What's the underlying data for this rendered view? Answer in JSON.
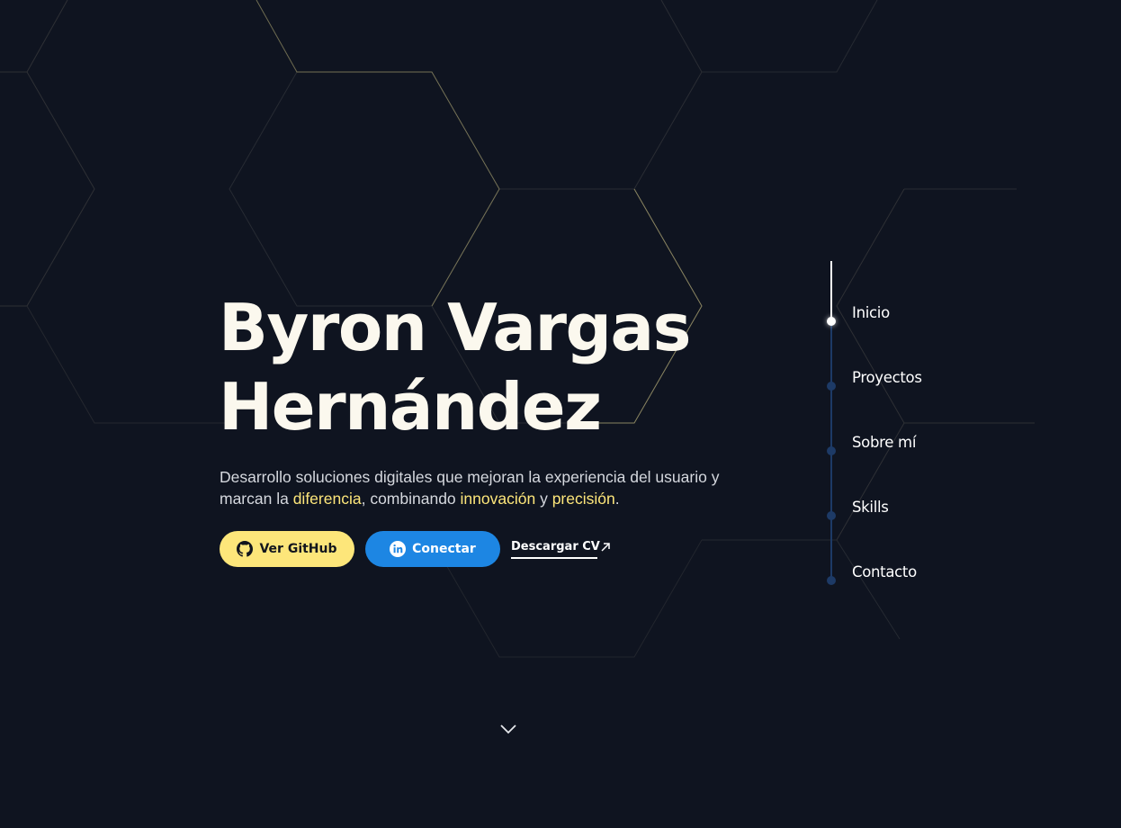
{
  "hero": {
    "name_line1": "Byron Vargas",
    "name_line2": "Hernández",
    "description": {
      "part1": "Desarrollo soluciones digitales que mejoran la experiencia del usuario y marcan la ",
      "highlight1": "diferencia",
      "part2": ", combinando ",
      "highlight2": "innovación",
      "part3": " y ",
      "highlight3": "precisión",
      "part4": "."
    }
  },
  "actions": {
    "github_label": "Ver GitHub",
    "linkedin_label": "Conectar",
    "cv_label": "Descargar CV"
  },
  "nav": {
    "items": [
      {
        "label": "Inicio",
        "active": true
      },
      {
        "label": "Proyectos",
        "active": false
      },
      {
        "label": "Sobre mí",
        "active": false
      },
      {
        "label": "Skills",
        "active": false
      },
      {
        "label": "Contacto",
        "active": false
      }
    ]
  },
  "icons": {
    "github": "github-icon",
    "linkedin": "linkedin-icon",
    "cv_arrow": "arrow-up-right-icon",
    "scroll": "chevron-down-icon"
  },
  "colors": {
    "background": "#0f1420",
    "accent_yellow": "#fde67a",
    "accent_blue": "#1d86e3",
    "nav_track": "#1d3a66",
    "text": "#fbf8ee"
  }
}
